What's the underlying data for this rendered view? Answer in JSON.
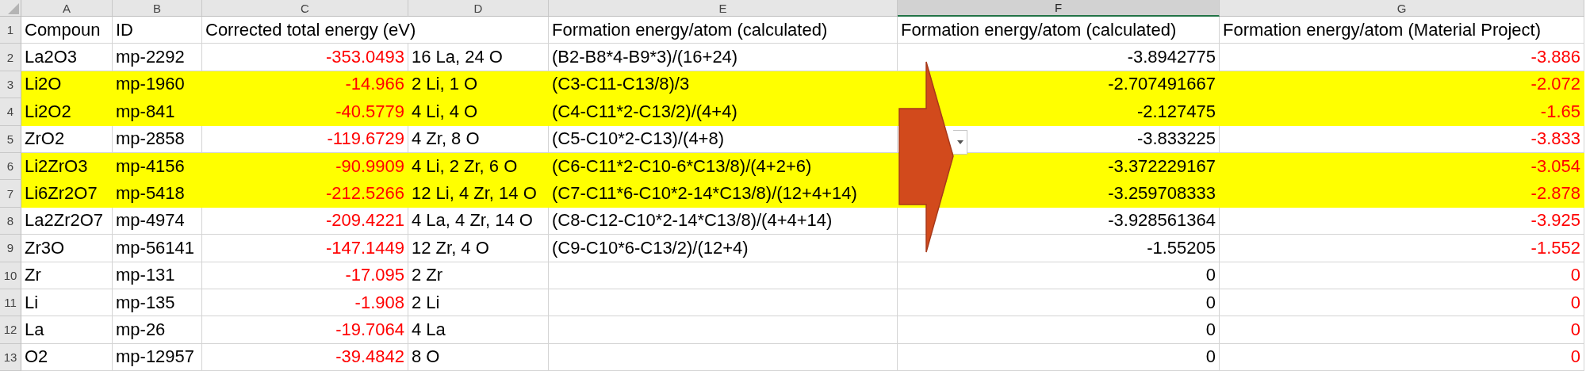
{
  "columns": [
    {
      "letter": "A",
      "selected": false,
      "color": "#000000",
      "numeric": false
    },
    {
      "letter": "B",
      "selected": false,
      "color": "#000000",
      "numeric": false
    },
    {
      "letter": "C",
      "selected": false,
      "color": "#ff0000",
      "numeric": true
    },
    {
      "letter": "D",
      "selected": false,
      "color": "#000000",
      "numeric": false
    },
    {
      "letter": "E",
      "selected": false,
      "color": "#000000",
      "numeric": false
    },
    {
      "letter": "F",
      "selected": true,
      "color": "#000000",
      "numeric": true
    },
    {
      "letter": "G",
      "selected": false,
      "color": "#ff0000",
      "numeric": true
    }
  ],
  "rows": [
    {
      "number": "1",
      "highlighted": false,
      "header": true,
      "cells": {
        "A": "Compoun",
        "B": "ID",
        "C": "Corrected total energy (eV)",
        "E": "Formation energy/atom (calculated)",
        "F": "Formation energy/atom (calculated)",
        "G": "Formation energy/atom (Material Project)"
      }
    },
    {
      "number": "2",
      "highlighted": false,
      "cells": {
        "A": "La2O3",
        "B": "mp-2292",
        "C": "-353.0493",
        "D": "16 La, 24 O",
        "E": "(B2-B8*4-B9*3)/(16+24)",
        "F": "-3.8942775",
        "G": "-3.886"
      }
    },
    {
      "number": "3",
      "highlighted": true,
      "cells": {
        "A": "Li2O",
        "B": "mp-1960",
        "C": "-14.966",
        "D": "2 Li, 1 O",
        "E": "(C3-C11-C13/8)/3",
        "F": "-2.707491667",
        "G": "-2.072"
      }
    },
    {
      "number": "4",
      "highlighted": true,
      "cells": {
        "A": "Li2O2",
        "B": "mp-841",
        "C": "-40.5779",
        "D": "4 Li, 4 O",
        "E": "(C4-C11*2-C13/2)/(4+4)",
        "F": "-2.127475",
        "G": "-1.65"
      }
    },
    {
      "number": "5",
      "highlighted": false,
      "cells": {
        "A": "ZrO2",
        "B": "mp-2858",
        "C": "-119.6729",
        "D": "4 Zr, 8 O",
        "E": "(C5-C10*2-C13)/(4+8)",
        "F": "-3.833225",
        "G": "-3.833"
      }
    },
    {
      "number": "6",
      "highlighted": true,
      "cells": {
        "A": "Li2ZrO3",
        "B": "mp-4156",
        "C": "-90.9909",
        "D": "4 Li, 2 Zr, 6 O",
        "E": "(C6-C11*2-C10-6*C13/8)/(4+2+6)",
        "F": "-3.372229167",
        "G": "-3.054"
      }
    },
    {
      "number": "7",
      "highlighted": true,
      "cells": {
        "A": "Li6Zr2O7",
        "B": "mp-5418",
        "C": "-212.5266",
        "D": "12 Li, 4 Zr, 14 O",
        "E": "(C7-C11*6-C10*2-14*C13/8)/(12+4+14)",
        "F": "-3.259708333",
        "G": "-2.878"
      }
    },
    {
      "number": "8",
      "highlighted": false,
      "cells": {
        "A": "La2Zr2O7",
        "B": "mp-4974",
        "C": "-209.4221",
        "D": "4 La, 4 Zr, 14 O",
        "E": "(C8-C12-C10*2-14*C13/8)/(4+4+14)",
        "F": "-3.928561364",
        "G": "-3.925"
      }
    },
    {
      "number": "9",
      "highlighted": false,
      "cells": {
        "A": "Zr3O",
        "B": "mp-56141",
        "C": "-147.1449",
        "D": "12 Zr, 4 O",
        "E": "(C9-C10*6-C13/2)/(12+4)",
        "F": "-1.55205",
        "G": "-1.552"
      }
    },
    {
      "number": "10",
      "highlighted": false,
      "cells": {
        "A": "Zr",
        "B": "mp-131",
        "C": "-17.095",
        "D": "2 Zr",
        "F": "0",
        "G": "0"
      }
    },
    {
      "number": "11",
      "highlighted": false,
      "cells": {
        "A": "Li",
        "B": "mp-135",
        "C": "-1.908",
        "D": "2 Li",
        "F": "0",
        "G": "0"
      }
    },
    {
      "number": "12",
      "highlighted": false,
      "cells": {
        "A": "La",
        "B": "mp-26",
        "C": "-19.7064",
        "D": "4 La",
        "F": "0",
        "G": "0"
      }
    },
    {
      "number": "13",
      "highlighted": false,
      "cells": {
        "A": "O2",
        "B": "mp-12957",
        "C": "-39.4842",
        "D": "8 O",
        "F": "0",
        "G": "0"
      }
    }
  ]
}
